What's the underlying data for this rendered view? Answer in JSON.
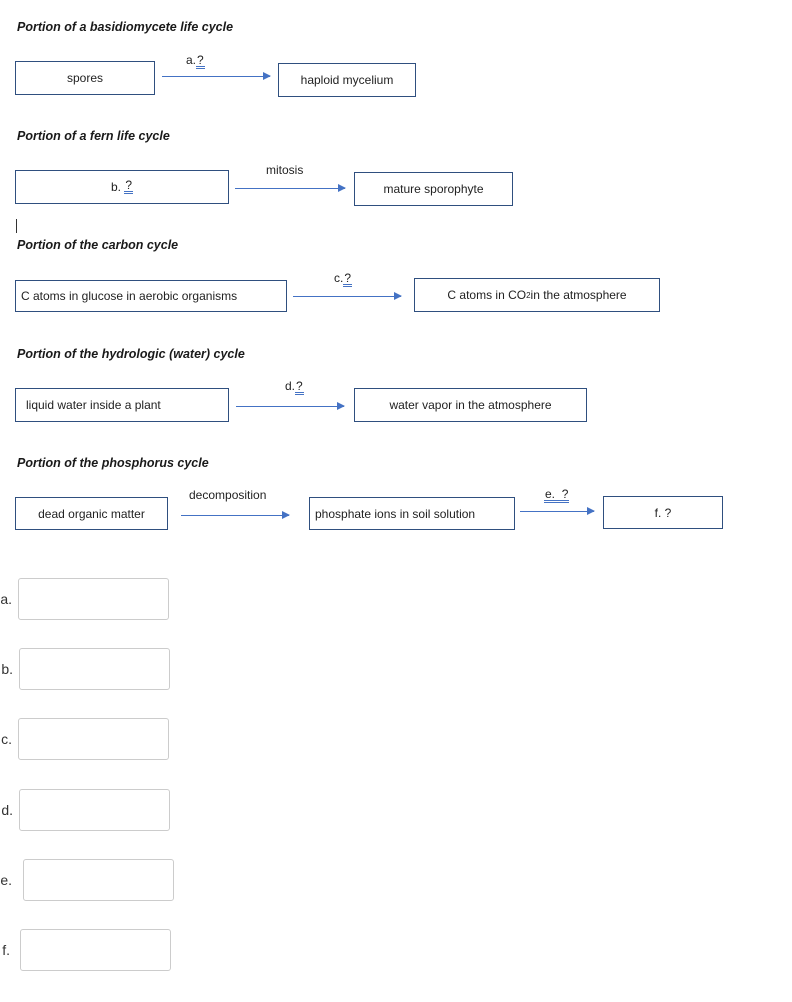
{
  "sections": [
    {
      "heading": "Portion of a basidiomycete life cycle",
      "boxes": [
        "spores",
        "haploid mycelium"
      ],
      "arrows": [
        {
          "prefix": "a.",
          "blank": "?"
        }
      ]
    },
    {
      "heading": "Portion of a fern life cycle",
      "boxes": [
        {
          "prefix": "b.",
          "blank": "?"
        },
        "mature sporophyte"
      ],
      "arrows": [
        {
          "text": "mitosis"
        }
      ]
    },
    {
      "heading": "Portion of the carbon cycle",
      "boxes": [
        "C atoms in glucose in aerobic organisms",
        {
          "before": "C atoms in CO",
          "sub": "2",
          "after": " in the atmosphere"
        }
      ],
      "arrows": [
        {
          "prefix": "c.",
          "blank": "?"
        }
      ]
    },
    {
      "heading": "Portion of the hydrologic (water) cycle",
      "boxes": [
        "liquid water inside a plant",
        "water vapor in the atmosphere"
      ],
      "arrows": [
        {
          "prefix": "d.",
          "blank": "?"
        }
      ]
    },
    {
      "heading": "Portion of the phosphorus cycle",
      "boxes": [
        "dead organic matter",
        "phosphate ions in soil solution",
        "f.  ?"
      ],
      "arrows": [
        {
          "text": "decomposition"
        },
        {
          "prefix": "e.",
          "blank": "?"
        }
      ]
    }
  ],
  "answers": [
    {
      "label": "a.",
      "value": ""
    },
    {
      "label": "b.",
      "value": ""
    },
    {
      "label": "c.",
      "value": ""
    },
    {
      "label": "d.",
      "value": ""
    },
    {
      "label": "e.",
      "value": ""
    },
    {
      "label": "f.",
      "value": ""
    }
  ],
  "colors": {
    "box_border": "#2f4f7f",
    "arrow": "#4472c4",
    "input_border": "#cccccc"
  }
}
